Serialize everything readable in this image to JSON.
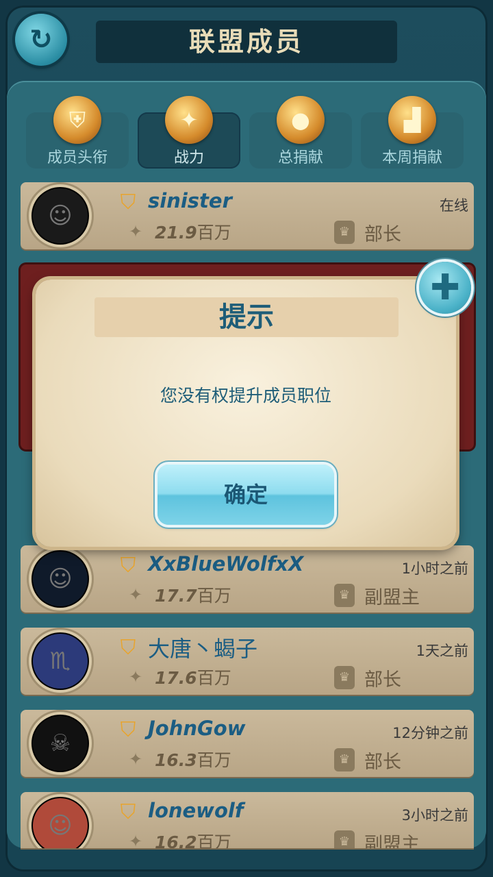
{
  "header": {
    "title": "联盟成员",
    "back_icon": "back-arrow-icon"
  },
  "tabs": [
    {
      "label": "成员头衔",
      "icon": "shield-badge-icon",
      "active": false
    },
    {
      "label": "战力",
      "icon": "eagle-emblem-icon",
      "active": true
    },
    {
      "label": "总捐献",
      "icon": "medal-icon",
      "active": false
    },
    {
      "label": "本周捐献",
      "icon": "podium-icon",
      "active": false
    }
  ],
  "members": [
    {
      "name": "sinister",
      "status": "在线",
      "power": "21.9",
      "power_unit": "百万",
      "role": "部长"
    },
    {
      "name": "XxBlueWolfxX",
      "status": "1小时之前",
      "power": "17.7",
      "power_unit": "百万",
      "role": "副盟主"
    },
    {
      "name": "大唐丶蝎子",
      "status": "1天之前",
      "power": "17.6",
      "power_unit": "百万",
      "role": "部长"
    },
    {
      "name": "JohnGow",
      "status": "12分钟之前",
      "power": "16.3",
      "power_unit": "百万",
      "role": "部长"
    },
    {
      "name": "lonewolf",
      "status": "3小时之前",
      "power": "16.2",
      "power_unit": "百万",
      "role": "副盟主"
    }
  ],
  "dialog": {
    "title": "提示",
    "message": "您没有权提升成员职位",
    "confirm_label": "确定",
    "close_icon": "close-x-icon"
  }
}
